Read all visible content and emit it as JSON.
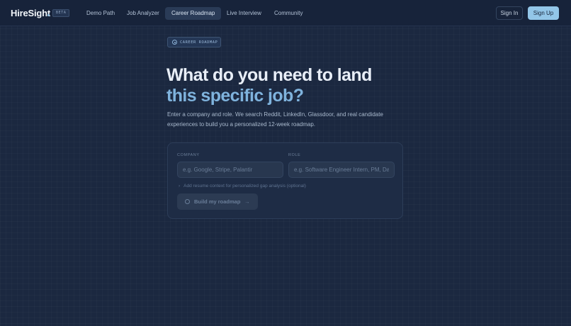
{
  "nav": {
    "logo": "HireSight",
    "badge": "BETA",
    "links": [
      "Demo Path",
      "Job Analyzer",
      "Career Roadmap",
      "Live Interview",
      "Community"
    ],
    "active_link": "Career Roadmap",
    "sign_in": "Sign In",
    "sign_up": "Sign Up"
  },
  "hero": {
    "badge": "CAREER ROADMAP",
    "title_line1": "What do you need to land",
    "title_line2": "this specific job?",
    "subtitle": "Enter a company and role. We search Reddit, LinkedIn, Glassdoor, and real candidate experiences to build you a personalized 12-week roadmap."
  },
  "form": {
    "company_label": "COMPANY",
    "company_placeholder": "e.g. Google, Stripe, Palantir",
    "company_value": "",
    "role_label": "ROLE",
    "role_placeholder": "e.g. Software Engineer Intern, PM, Data Scientist",
    "role_value": "",
    "resume_toggle": "Add resume context for personalized gap analysis (optional)",
    "submit_label": "Build my roadmap",
    "submit_arrow": "→",
    "chevron": "›"
  },
  "colors": {
    "background": "#1b2840",
    "accent": "#93c6e8",
    "title_accent": "#7fb3dd"
  }
}
